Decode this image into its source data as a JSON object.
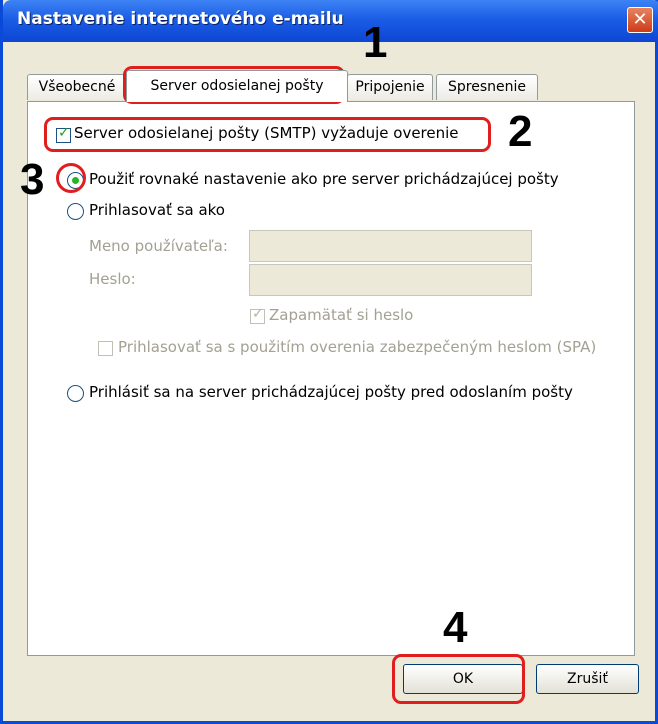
{
  "window": {
    "title": "Nastavenie internetového e-mailu",
    "close_glyph": "✕"
  },
  "tabs": [
    {
      "label": "Všeobecné"
    },
    {
      "label": "Server odosielanej pošty"
    },
    {
      "label": "Pripojenie"
    },
    {
      "label": "Spresnenie"
    }
  ],
  "panel": {
    "smtp_auth_label": "Server odosielanej pošty (SMTP) vyžaduje overenie",
    "radio_same_label": "Použiť rovnaké nastavenie ako pre server prichádzajúcej pošty",
    "radio_login_label": "Prihlasovať sa ako",
    "username_label": "Meno používateľa:",
    "username_value": "",
    "password_label": "Heslo:",
    "password_value": "",
    "remember_label": "Zapamätať si heslo",
    "spa_label": "Prihlasovať sa s použitím overenia zabezpečeným heslom (SPA)",
    "radio_prelogin_label": "Prihlásiť sa na server prichádzajúcej pošty pred odoslaním pošty"
  },
  "buttons": {
    "ok": "OK",
    "cancel": "Zrušiť"
  },
  "annotations": [
    "1",
    "2",
    "3",
    "4"
  ],
  "colors": {
    "highlight": "#e01e1e",
    "titlebar": "#0d46d3"
  }
}
